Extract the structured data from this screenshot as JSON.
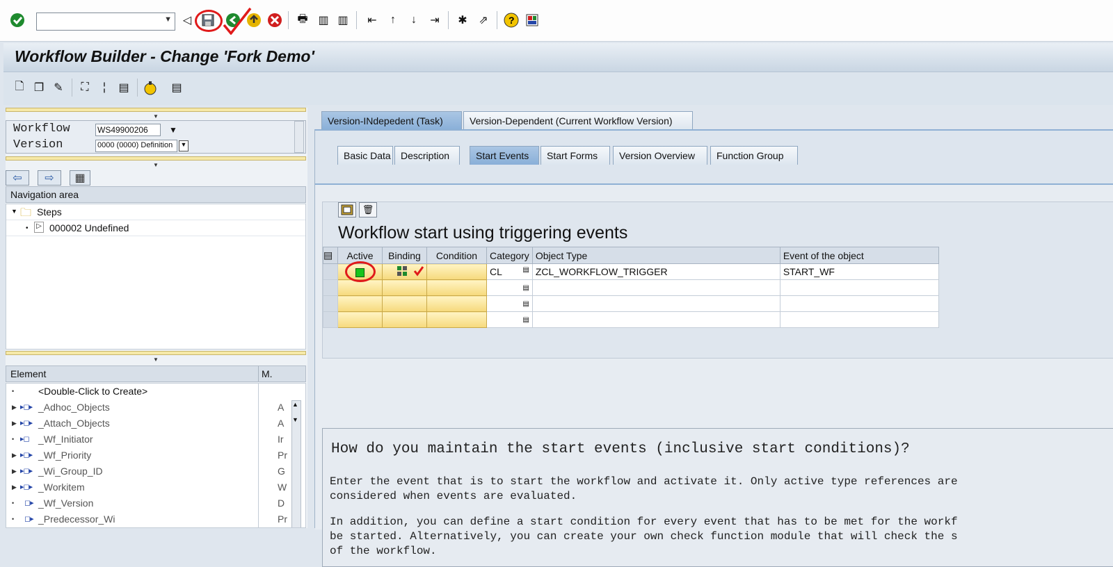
{
  "toolbar": {
    "command_value": "",
    "icons": [
      "enter-icon",
      "back-icon",
      "save-icon",
      "exit-icon",
      "cancel-icon",
      "print-icon",
      "find-icon",
      "find-next-icon",
      "first-page-icon",
      "prev-page-icon",
      "next-page-icon",
      "last-page-icon",
      "new-session-icon",
      "shortcut-icon",
      "help-icon",
      "layout-icon"
    ]
  },
  "window": {
    "title": "Workflow Builder - Change 'Fork Demo'"
  },
  "left": {
    "workflow_label": "Workflow",
    "workflow_value": "WS49900206",
    "version_label": "Version",
    "version_value": "0000 (0000) Definition",
    "nav_header": "Navigation area",
    "tree": [
      {
        "label": "Steps"
      },
      {
        "label": "000002 Undefined"
      }
    ],
    "element_header": "Element",
    "m_header": "M.",
    "elements": [
      {
        "name": "<Double-Click to Create>",
        "m": ""
      },
      {
        "name": "_Adhoc_Objects",
        "m": "A"
      },
      {
        "name": "_Attach_Objects",
        "m": "A"
      },
      {
        "name": "_Wf_Initiator",
        "m": "Ir"
      },
      {
        "name": "_Wf_Priority",
        "m": "Pr"
      },
      {
        "name": "_Wi_Group_ID",
        "m": "G"
      },
      {
        "name": "_Workitem",
        "m": "W"
      },
      {
        "name": "_Wf_Version",
        "m": "D"
      },
      {
        "name": "_Predecessor_Wi",
        "m": "Pr"
      }
    ]
  },
  "tabs_top": [
    "Version-INdepedent (Task)",
    "Version-Dependent (Current Workflow Version)"
  ],
  "tabs_sub": [
    "Basic Data",
    "Description",
    "Start Events",
    "Start Forms",
    "Version Overview",
    "Function Group"
  ],
  "section_title": "Workflow start using triggering events",
  "events_table": {
    "columns": [
      "Active",
      "Binding",
      "Condition",
      "Category",
      "Object Type",
      "Event of the object"
    ],
    "rows": [
      {
        "category": "CL",
        "object_type": "ZCL_WORKFLOW_TRIGGER",
        "event": "START_WF"
      },
      {
        "category": "",
        "object_type": "",
        "event": ""
      },
      {
        "category": "",
        "object_type": "",
        "event": ""
      },
      {
        "category": "",
        "object_type": "",
        "event": ""
      }
    ]
  },
  "help": {
    "question": "How do you maintain the start events (inclusive start conditions)?",
    "para1_line1": "Enter the event that is to start the workflow and activate it. Only active type references are",
    "para1_line2": "considered when events are evaluated.",
    "para2_line1": "In addition, you can define a start condition for every event that has to be met for the workf",
    "para2_line2": "be started. Alternatively, you can create your own check function module that will check the s",
    "para2_line3": "of the workflow."
  },
  "colors": {
    "title_bg": "#c9d6e3",
    "active_tab": "#89afd8",
    "active_flag": "#17c41c",
    "annotation": "#e01a1a"
  }
}
